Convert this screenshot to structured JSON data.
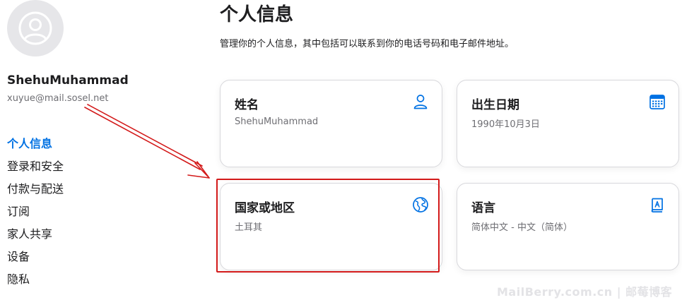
{
  "user": {
    "name": "ShehuMuhammad",
    "email": "xuyue@mail.sosel.net"
  },
  "sidebar": {
    "items": [
      {
        "label": "个人信息",
        "active": true
      },
      {
        "label": "登录和安全",
        "active": false
      },
      {
        "label": "付款与配送",
        "active": false
      },
      {
        "label": "订阅",
        "active": false
      },
      {
        "label": "家人共享",
        "active": false
      },
      {
        "label": "设备",
        "active": false
      },
      {
        "label": "隐私",
        "active": false
      }
    ]
  },
  "main": {
    "title": "个人信息",
    "description": "管理你的个人信息，其中包括可以联系到你的电话号码和电子邮件地址。",
    "cards": {
      "name": {
        "title": "姓名",
        "value": "ShehuMuhammad",
        "icon": "person-icon"
      },
      "birthday": {
        "title": "出生日期",
        "value": "1990年10月3日",
        "icon": "calendar-icon"
      },
      "country": {
        "title": "国家或地区",
        "value": "土耳其",
        "icon": "globe-icon"
      },
      "language": {
        "title": "语言",
        "value": "简体中文 - 中文（简体）",
        "icon": "book-icon"
      }
    }
  },
  "watermark": "MailBerry.com.cn | 邮莓博客",
  "colors": {
    "accent": "#0071e3",
    "annotation": "#d31a1a",
    "text_primary": "#1d1d1f",
    "text_secondary": "#6e6e73"
  }
}
